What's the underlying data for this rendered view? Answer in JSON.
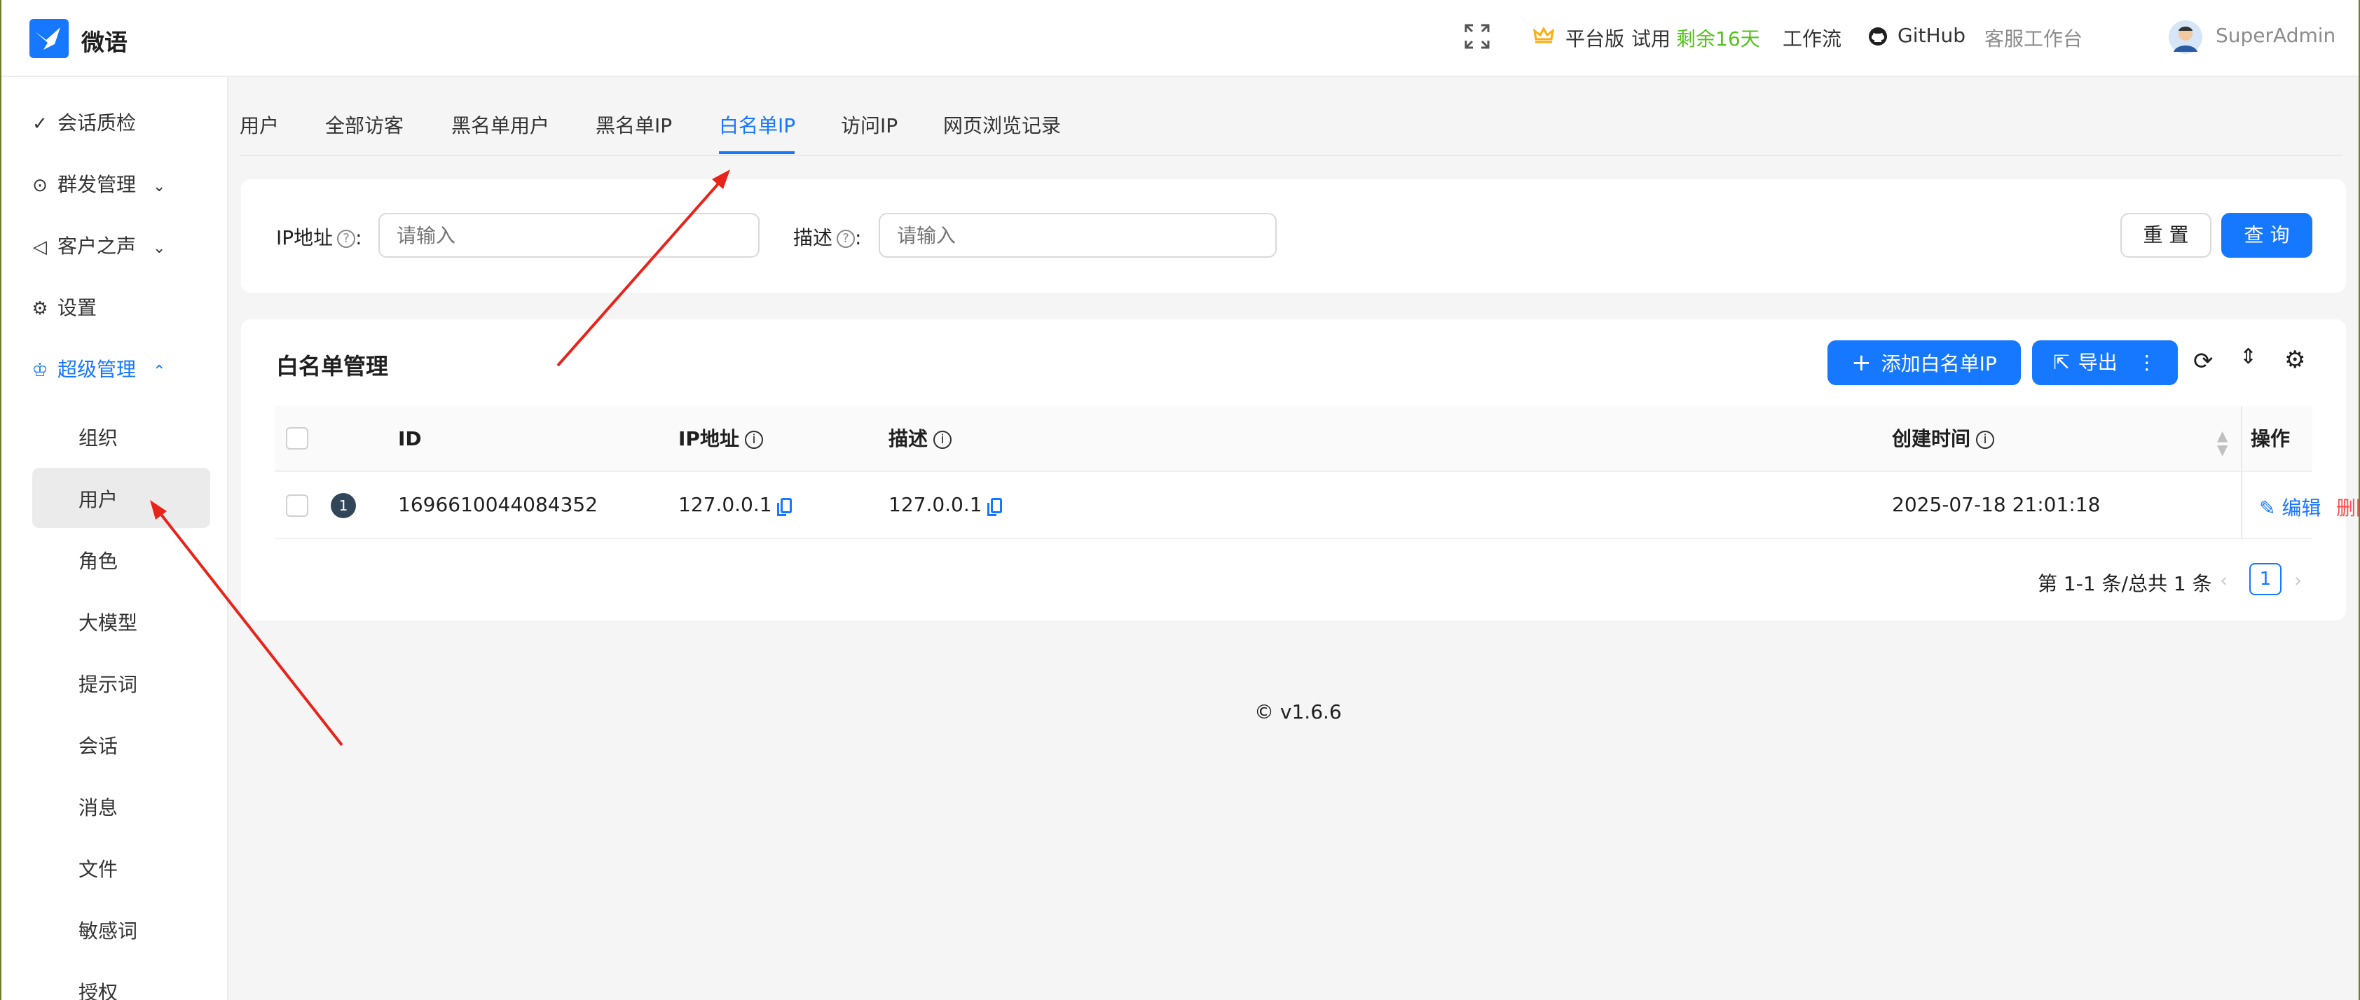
{
  "app": {
    "name": "微语"
  },
  "header": {
    "fullscreen_icon": "fullscreen-icon",
    "plan_icon": "crown-icon",
    "plan_label": "平台版",
    "trial_label": "试用",
    "trial_remaining": "剩余16天",
    "workflow": "工作流",
    "github": "GitHub",
    "workbench": "客服工作台",
    "user": "SuperAdmin"
  },
  "sidebar": {
    "items": [
      {
        "label": "会话质检",
        "icon": "check-icon"
      },
      {
        "label": "群发管理",
        "icon": "message-icon"
      },
      {
        "label": "客户之声",
        "icon": "sound-icon"
      },
      {
        "label": "设置",
        "icon": "gear-icon"
      },
      {
        "label": "超级管理",
        "icon": "crown-icon"
      }
    ],
    "subitems": [
      "组织",
      "用户",
      "角色",
      "大模型",
      "提示词",
      "会话",
      "消息",
      "文件",
      "敏感词",
      "授权"
    ]
  },
  "tabs": [
    "用户",
    "全部访客",
    "黑名单用户",
    "黑名单IP",
    "白名单IP",
    "访问IP",
    "网页浏览记录"
  ],
  "search": {
    "ip_label": "IP地址",
    "ip_placeholder": "请输入",
    "desc_label": "描述",
    "desc_placeholder": "请输入",
    "reset": "重 置",
    "query": "查 询"
  },
  "table": {
    "title": "白名单管理",
    "add_button": "添加白名单IP",
    "export_button": "导出",
    "columns": [
      "ID",
      "IP地址",
      "描述",
      "创建时间",
      "操作"
    ],
    "rows": [
      {
        "index": "1",
        "id": "1696610044084352",
        "ip": "127.0.0.1",
        "desc": "127.0.0.1",
        "created": "2025-07-18 21:01:18",
        "edit": "编辑",
        "delete": "删除"
      }
    ],
    "pagination": {
      "summary": "第 1-1 条/总共 1 条",
      "current": "1"
    }
  },
  "footer": {
    "version": "v1.6.6"
  },
  "colors": {
    "primary": "#1677ff",
    "danger": "#ff4d4f",
    "success": "#52c41a",
    "warning": "#faad14"
  }
}
